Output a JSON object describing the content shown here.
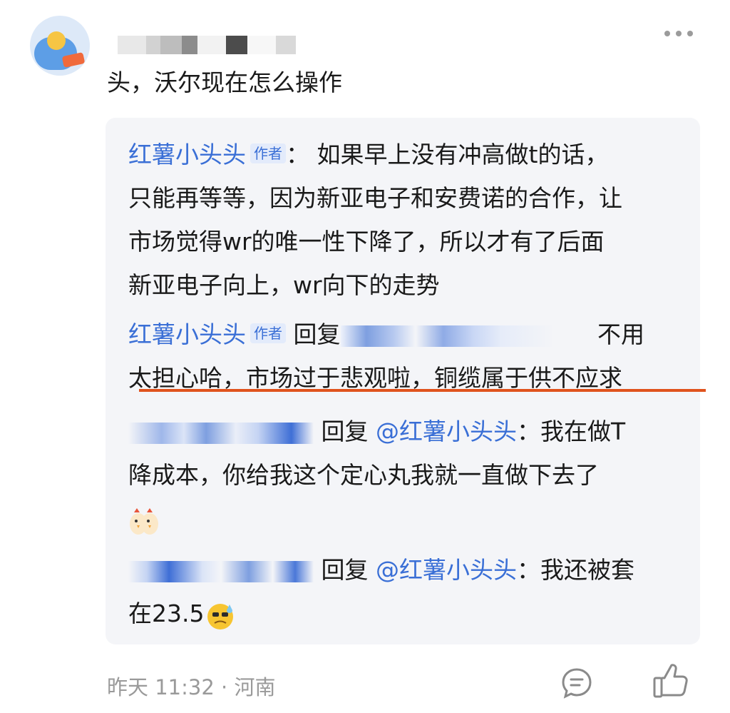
{
  "comment": {
    "text": "头，沃尔现在怎么操作"
  },
  "replies": [
    {
      "author": "红薯小头头",
      "tag": "作者",
      "separator": "：",
      "lines": [
        "如果早上没有冲高做t的话，",
        "只能再等等，因为新亚电子和安费诺的合作，让",
        "市场觉得wr的唯一性下降了，所以才有了后面",
        "新亚电子向上，wr向下的走势"
      ]
    },
    {
      "author": "红薯小头头",
      "tag": "作者",
      "reply_prefix": "回复",
      "tail": "不用",
      "lines": [
        "太担心哈，市场过于悲观啦，铜缆属于供不应求"
      ]
    },
    {
      "reply_prefix": "回复",
      "mention": "@红薯小头头",
      "separator": "：",
      "first_text": "我在做T",
      "lines": [
        "降成本，你给我这个定心丸我就一直做下去了"
      ],
      "emoji": "chick-emoji"
    },
    {
      "reply_prefix": "回复",
      "mention": "@红薯小头头",
      "separator": "：",
      "first_text": "我还被套",
      "lines": [
        "在23.5"
      ],
      "emoji": "sweat-face-emoji"
    }
  ],
  "footer": {
    "time": "昨天 11:32 · 河南"
  },
  "icons": {
    "more": "more-icon",
    "reply": "reply-icon",
    "like": "like-icon"
  },
  "colors": {
    "link": "#3a6fd6",
    "highlight_underline": "#e0531d",
    "reply_bg": "#f4f5f8",
    "meta": "#9a9a9a"
  }
}
